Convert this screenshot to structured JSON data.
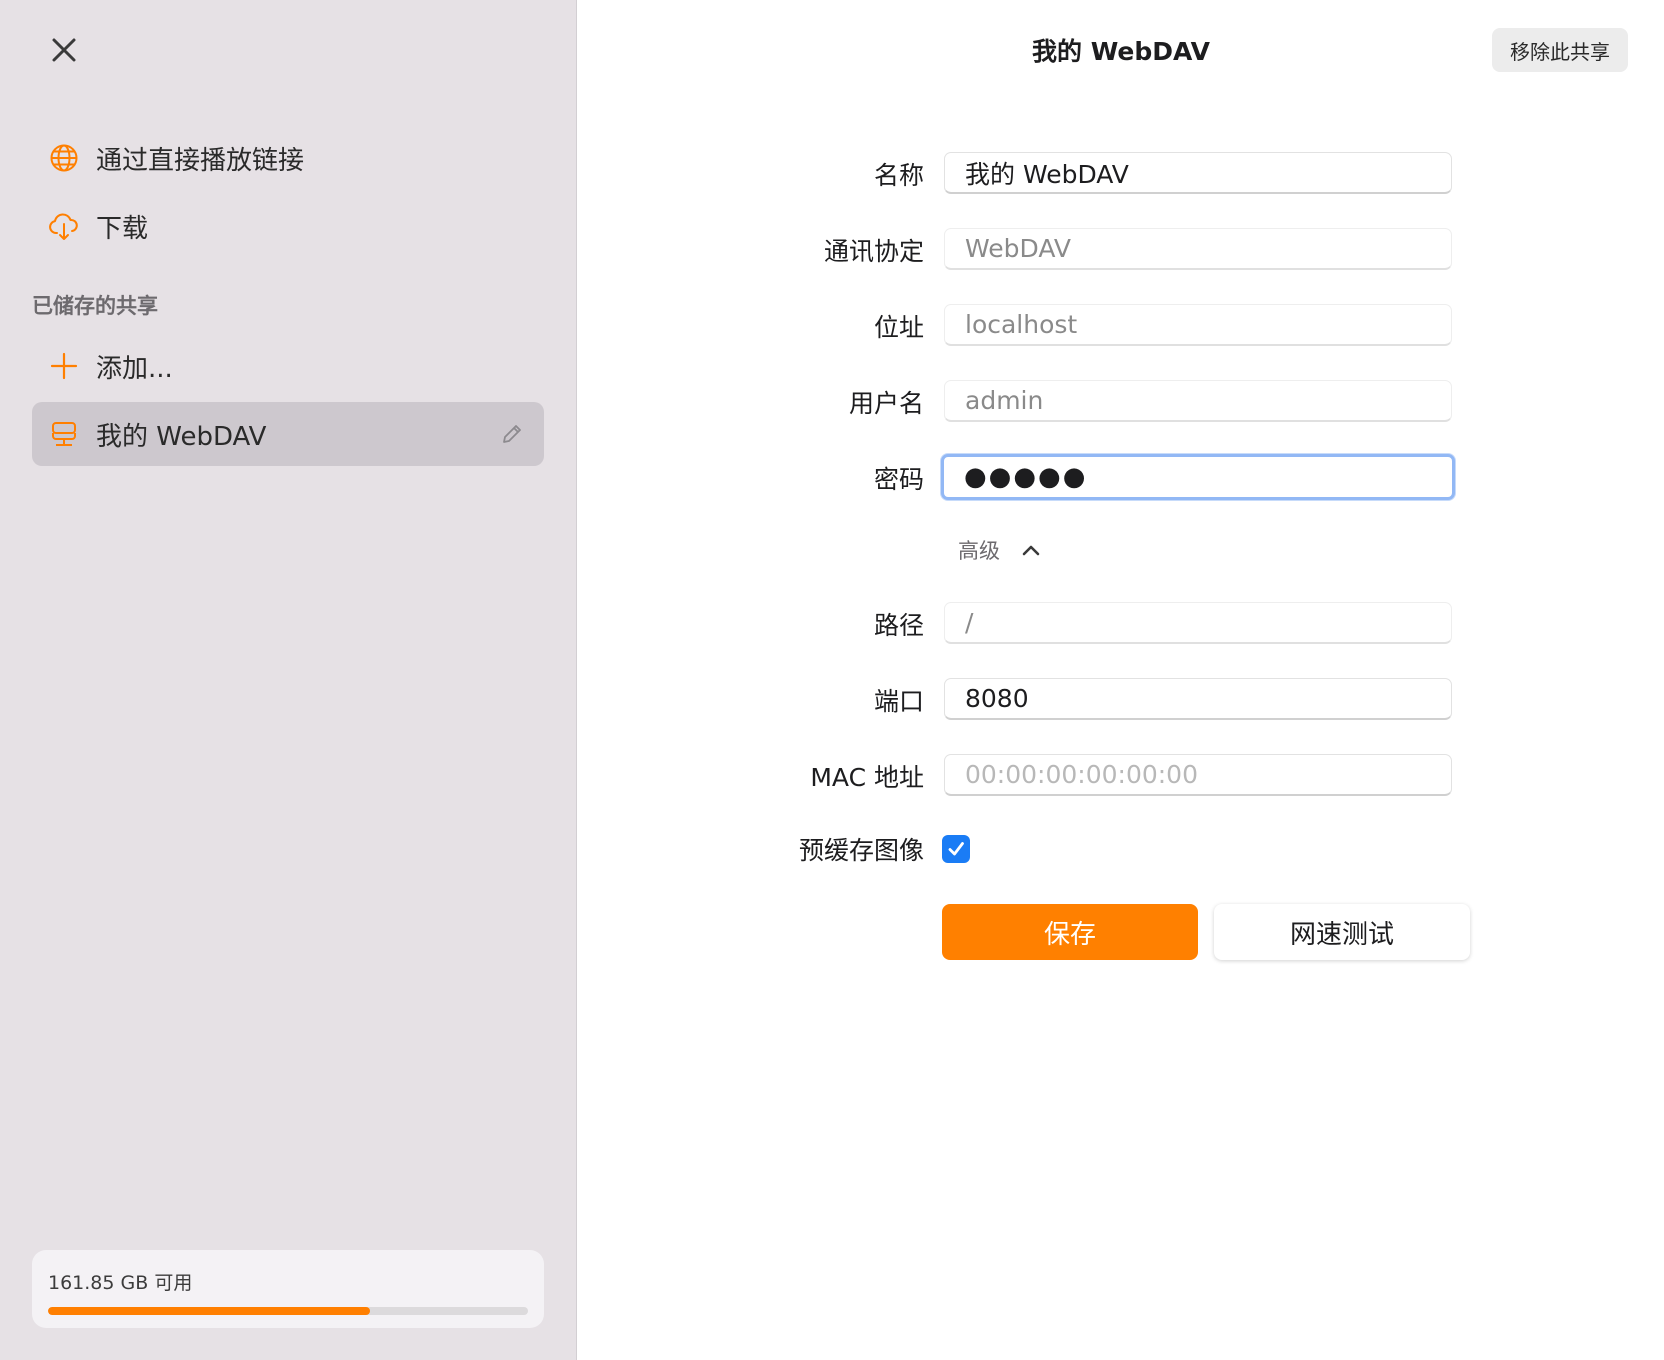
{
  "sidebar": {
    "nav": [
      {
        "label": "通过直接播放链接",
        "icon": "globe-icon"
      },
      {
        "label": "下载",
        "icon": "cloud-download-icon"
      }
    ],
    "section_title": "已储存的共享",
    "add_label": "添加...",
    "shares": [
      {
        "label": "我的 WebDAV",
        "icon": "server-icon",
        "selected": true
      }
    ],
    "storage": {
      "text": "161.85 GB 可用",
      "used_fraction": 0.67
    }
  },
  "main": {
    "title": "我的 WebDAV",
    "remove_button": "移除此共享",
    "fields": {
      "name": {
        "label": "名称",
        "value": "我的 WebDAV"
      },
      "protocol": {
        "label": "通讯协定",
        "value": "WebDAV"
      },
      "address": {
        "label": "位址",
        "value": "localhost"
      },
      "username": {
        "label": "用户名",
        "value": "admin"
      },
      "password": {
        "label": "密码",
        "value": "●●●●●"
      },
      "path": {
        "label": "路径",
        "value": "/"
      },
      "port": {
        "label": "端口",
        "value": "8080"
      },
      "mac": {
        "label": "MAC 地址",
        "placeholder": "00:00:00:00:00:00"
      },
      "precache": {
        "label": "预缓存图像",
        "checked": true
      }
    },
    "advanced_label": "高级",
    "save_button": "保存",
    "speed_test_button": "网速测试"
  },
  "colors": {
    "accent": "#ff8000",
    "checkbox": "#1a7cf5",
    "sidebar_bg": "#e6e1e5"
  }
}
